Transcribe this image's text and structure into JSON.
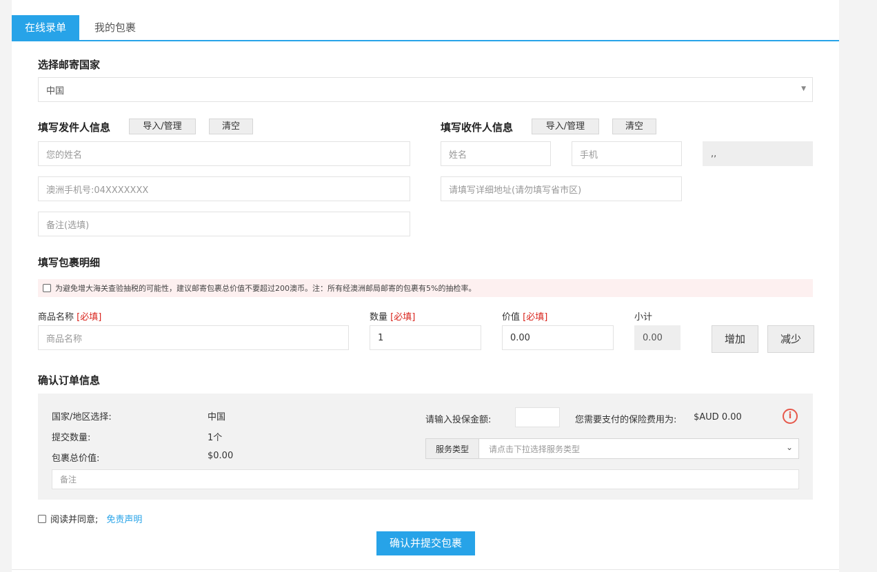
{
  "tabs": [
    {
      "label": "在线录单",
      "active": true
    },
    {
      "label": "我的包裹",
      "active": false
    }
  ],
  "country_section": {
    "title": "选择邮寄国家",
    "selected": "中国"
  },
  "sender": {
    "title": "填写发件人信息",
    "import_btn": "导入/管理",
    "clear_btn": "清空",
    "name_placeholder": "您的姓名",
    "phone_placeholder": "澳洲手机号:04XXXXXXX",
    "note_placeholder": "备注(选填)"
  },
  "receiver": {
    "title": "填写收件人信息",
    "import_btn": "导入/管理",
    "clear_btn": "清空",
    "name_placeholder": "姓名",
    "phone_placeholder": "手机",
    "region_value": ",,",
    "address_placeholder": "请填写详细地址(请勿填写省市区)"
  },
  "parcel": {
    "title": "填写包裹明细",
    "notice": "为避免增大海关查验抽税的可能性，建议邮寄包裹总价值不要超过200澳币。注：所有经澳洲邮局邮寄的包裹有5%的抽检率。",
    "product_label": "商品名称",
    "product_required": "[必填]",
    "product_placeholder": "商品名称",
    "qty_label": "数量",
    "qty_required": "[必填]",
    "qty_value": "1",
    "price_label": "价值",
    "price_required": "[必填]",
    "price_value": "0.00",
    "subtotal_label": "小计",
    "subtotal_value": "0.00",
    "add_btn": "增加",
    "remove_btn": "减少"
  },
  "confirm": {
    "title": "确认订单信息",
    "country_label": "国家/地区选择:",
    "country_value": "中国",
    "qty_label": "提交数量:",
    "qty_value": "1个",
    "total_label": "包裹总价值:",
    "total_value": "$0.00",
    "insurance_label": "请输入投保金额:",
    "insurance_fee_text": "您需要支付的保险费用为:",
    "insurance_fee_value": "$AUD 0.00",
    "service_label": "服务类型",
    "service_placeholder": "请点击下拉选择服务类型",
    "note_placeholder": "备注",
    "info_icon": "i"
  },
  "agreement": {
    "text": "阅读并同意;",
    "link": "免责声明"
  },
  "submit_label": "确认并提交包裹",
  "colors": {
    "accent": "#27a3e8",
    "required": "#d9251d",
    "notice_bg": "#fdf0f0",
    "info_icon": "#e6584b"
  }
}
